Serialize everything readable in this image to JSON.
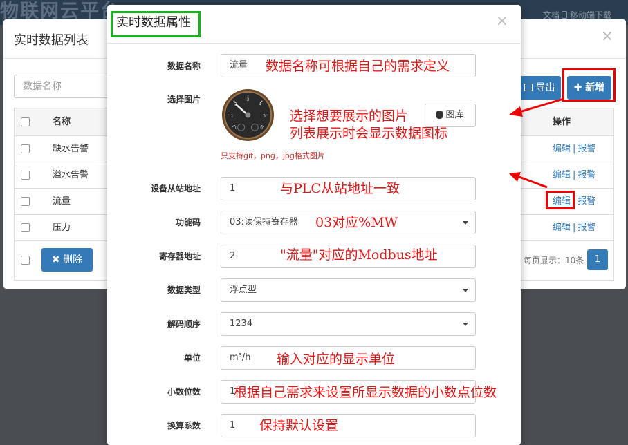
{
  "app": {
    "logo_text": "物联网云平台",
    "doc_link": "文档",
    "mobile_link": "移动端下载"
  },
  "list_modal": {
    "title": "实时数据列表",
    "close": "×",
    "search_placeholder": "数据名称",
    "export_label": "导出",
    "add_label": "新增",
    "columns": {
      "name": "名称",
      "ops": "操作"
    },
    "rows": [
      {
        "name": "缺水告警",
        "edit": "编辑",
        "alarm": "报警"
      },
      {
        "name": "溢水告警",
        "edit": "编辑",
        "alarm": "报警"
      },
      {
        "name": "流量",
        "edit": "编辑",
        "alarm": "报警"
      },
      {
        "name": "压力",
        "edit": "编辑",
        "alarm": "报警"
      }
    ],
    "op_separator": "|",
    "delete_label": "删除",
    "per_page": "每页显示：10条",
    "page": "1"
  },
  "prop_modal": {
    "title": "实时数据属性",
    "close": "×",
    "fields": {
      "name": {
        "label": "数据名称",
        "value": "流量"
      },
      "image": {
        "label": "选择图片",
        "library_label": "图库",
        "hint": "只支持gif，png，jpg格式图片"
      },
      "slave_addr": {
        "label": "设备从站地址",
        "value": "1"
      },
      "func_code": {
        "label": "功能码",
        "value": "03:读保持寄存器"
      },
      "reg_addr": {
        "label": "寄存器地址",
        "value": "2"
      },
      "data_type": {
        "label": "数据类型",
        "value": "浮点型"
      },
      "decode_order": {
        "label": "解码顺序",
        "value": "1234"
      },
      "unit": {
        "label": "单位",
        "value": "m³/h"
      },
      "decimals": {
        "label": "小数位数",
        "value": "1"
      },
      "conversion": {
        "label": "换算系数",
        "value": "1"
      }
    }
  },
  "annotations": {
    "name_note": "数据名称可根据自己的需求定义",
    "image_note_1": "选择想要展示的图片",
    "image_note_2": "列表展示时会显示数据图标",
    "slave_note": "与PLC从站地址一致",
    "func_note": "03对应%MW",
    "reg_note": "\"流量\"对应的Modbus地址",
    "unit_note": "输入对应的显示单位",
    "decimals_note": "根据自己需求来设置所显示数据的小数点位数",
    "conversion_note": "保持默认设置"
  },
  "colors": {
    "primary": "#337ab7",
    "annotation_red": "#e01818",
    "highlight_green": "#14b81a"
  }
}
